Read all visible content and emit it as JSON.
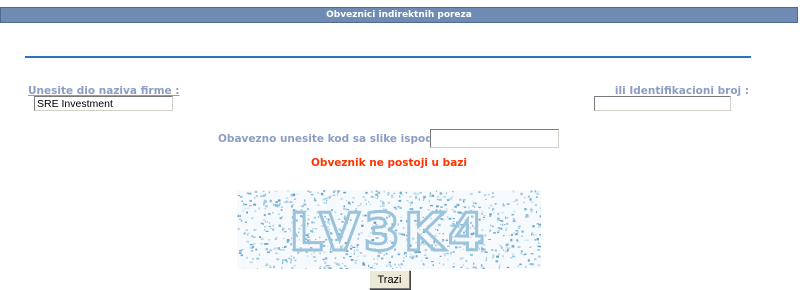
{
  "header": {
    "title": "Obveznici indirektnih poreza"
  },
  "form": {
    "firm_label": "Unesite dio naziva firme :",
    "firm_value": "SRE Investment",
    "id_label": "ili Identifikacioni broj :",
    "id_value": "",
    "code_label": "Obavezno unesite kod sa slike ispod:",
    "code_value": ""
  },
  "message": {
    "error_text": "Obveznik ne postoji u bazi"
  },
  "captcha": {
    "text": "LV3K4"
  },
  "actions": {
    "search_label": "Trazi"
  },
  "colors": {
    "header_bg": "#6e8bb4",
    "divider": "#2a72c4",
    "label": "#8c9cc4",
    "error": "#ff3300",
    "captcha_text": "#9bc3dc"
  }
}
